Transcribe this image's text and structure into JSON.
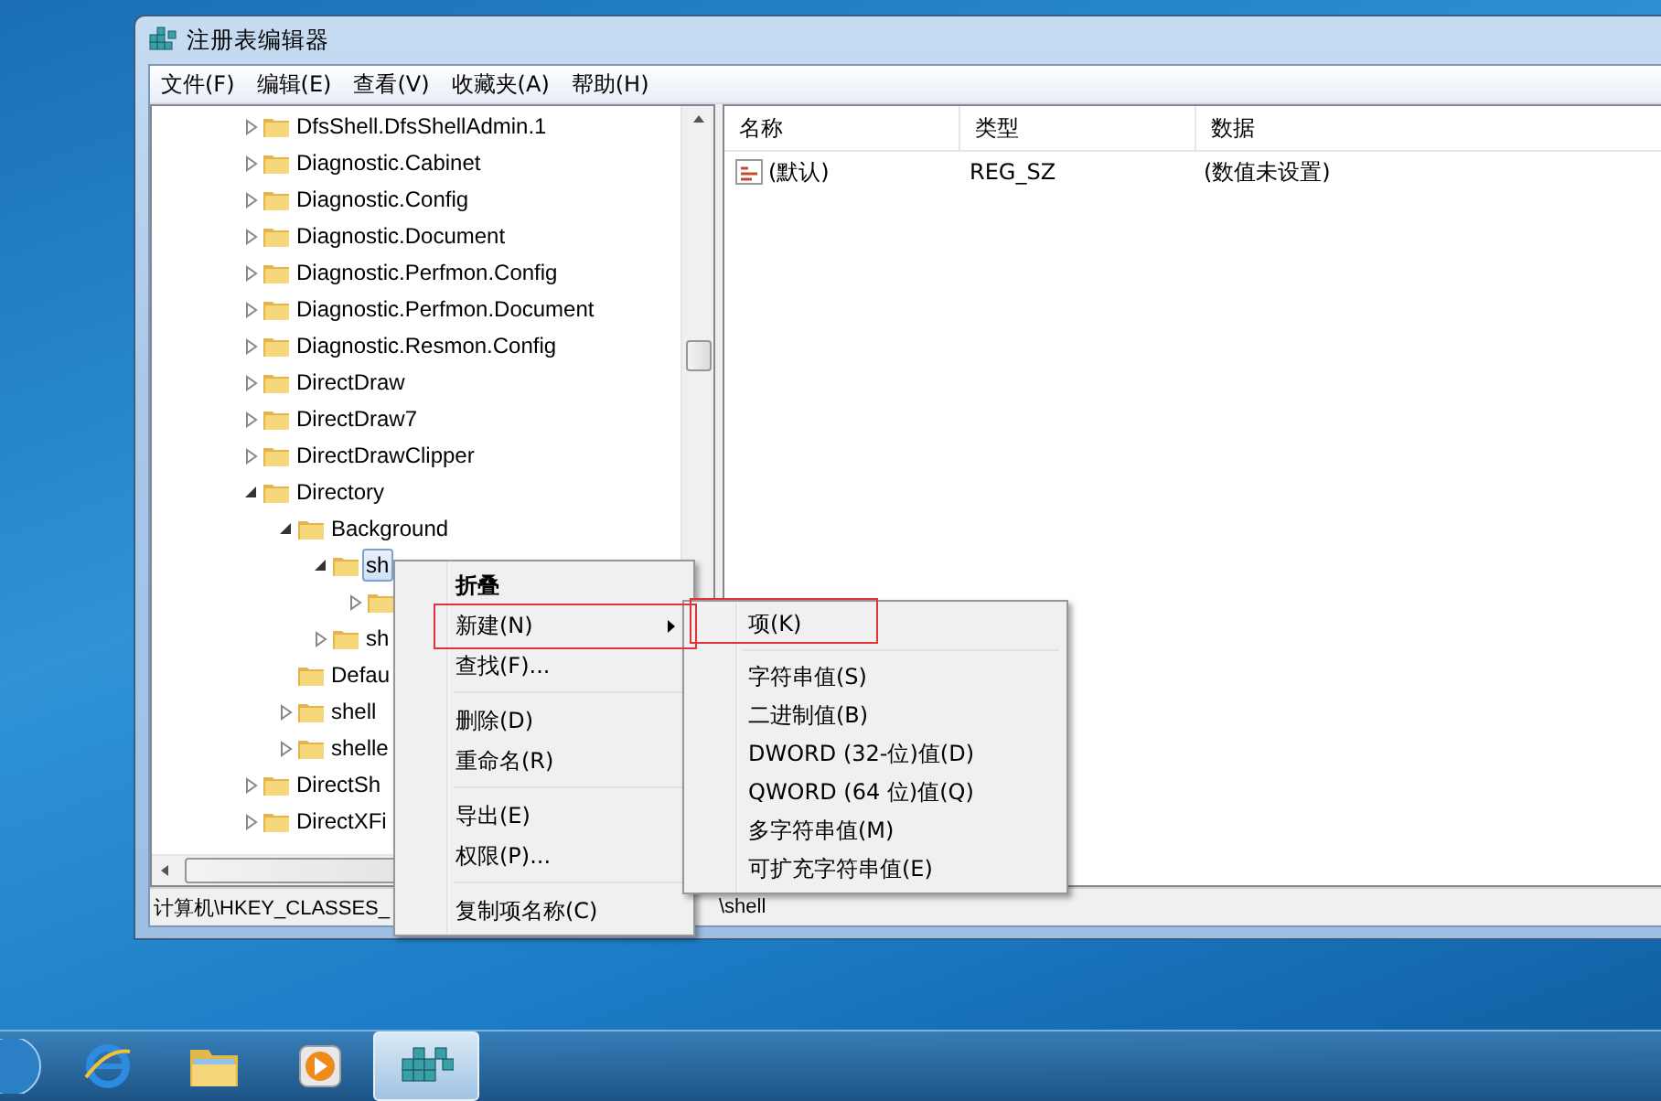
{
  "window": {
    "title": "注册表编辑器"
  },
  "menu_bar": [
    "文件(F)",
    "编辑(E)",
    "查看(V)",
    "收藏夹(A)",
    "帮助(H)"
  ],
  "tree": {
    "items": [
      {
        "label": "DfsShell.DfsShellAdmin.1",
        "kind": "branch",
        "expanded": false,
        "selected": false
      },
      {
        "label": "Diagnostic.Cabinet",
        "kind": "branch",
        "expanded": false,
        "selected": false
      },
      {
        "label": "Diagnostic.Config",
        "kind": "branch",
        "expanded": false,
        "selected": false
      },
      {
        "label": "Diagnostic.Document",
        "kind": "branch",
        "expanded": false,
        "selected": false
      },
      {
        "label": "Diagnostic.Perfmon.Config",
        "kind": "branch",
        "expanded": false,
        "selected": false
      },
      {
        "label": "Diagnostic.Perfmon.Document",
        "kind": "branch",
        "expanded": false,
        "selected": false
      },
      {
        "label": "Diagnostic.Resmon.Config",
        "kind": "branch",
        "expanded": false,
        "selected": false
      },
      {
        "label": "DirectDraw",
        "kind": "branch",
        "expanded": false,
        "selected": false
      },
      {
        "label": "DirectDraw7",
        "kind": "branch",
        "expanded": false,
        "selected": false
      },
      {
        "label": "DirectDrawClipper",
        "kind": "branch",
        "expanded": false,
        "selected": false
      },
      {
        "label": "Directory",
        "kind": "branch",
        "expanded": true,
        "selected": false,
        "children": [
          {
            "label": "Background",
            "kind": "branch",
            "expanded": true,
            "selected": false,
            "children": [
              {
                "label": "sh",
                "kind": "branch",
                "expanded": true,
                "selected": true,
                "children": [
                  {
                    "kind": "branch",
                    "expanded": false,
                    "selected": false
                  }
                ]
              },
              {
                "label": "sh",
                "kind": "branch",
                "expanded": false,
                "selected": false
              }
            ]
          },
          {
            "label": "Defau",
            "kind": "leaf",
            "selected": false
          },
          {
            "label": "shell",
            "kind": "branch",
            "expanded": false,
            "selected": false
          },
          {
            "label": "shelle",
            "kind": "branch",
            "expanded": false,
            "selected": false
          }
        ]
      },
      {
        "label": "DirectSh",
        "kind": "branch",
        "expanded": false,
        "selected": false
      },
      {
        "label": "DirectXFi",
        "kind": "branch",
        "expanded": false,
        "selected": false
      }
    ]
  },
  "values": {
    "columns": [
      "名称",
      "类型",
      "数据"
    ],
    "rows": [
      {
        "name": "(默认)",
        "type": "REG_SZ",
        "data": "(数值未设置)"
      }
    ]
  },
  "status_bar": [
    "计算机\\HKEY_CLASSES_",
    "\\shell"
  ],
  "context_menu": {
    "items": [
      {
        "kind": "item",
        "label": "折叠",
        "bold": true,
        "submenu": false
      },
      {
        "kind": "item",
        "label": "新建(N)",
        "bold": false,
        "submenu": true
      },
      {
        "kind": "item",
        "label": "查找(F)...",
        "bold": false,
        "submenu": false
      },
      {
        "kind": "separator"
      },
      {
        "kind": "item",
        "label": "删除(D)",
        "bold": false,
        "submenu": false
      },
      {
        "kind": "item",
        "label": "重命名(R)",
        "bold": false,
        "submenu": false
      },
      {
        "kind": "separator"
      },
      {
        "kind": "item",
        "label": "导出(E)",
        "bold": false,
        "submenu": false
      },
      {
        "kind": "item",
        "label": "权限(P)...",
        "bold": false,
        "submenu": false
      },
      {
        "kind": "separator"
      },
      {
        "kind": "item",
        "label": "复制项名称(C)",
        "bold": false,
        "submenu": false
      }
    ]
  },
  "submenu": {
    "items": [
      {
        "kind": "item",
        "label": "项(K)"
      },
      {
        "kind": "separator"
      },
      {
        "kind": "item",
        "label": "字符串值(S)"
      },
      {
        "kind": "item",
        "label": "二进制值(B)"
      },
      {
        "kind": "item",
        "label": "DWORD (32-位)值(D)"
      },
      {
        "kind": "item",
        "label": "QWORD (64 位)值(Q)"
      },
      {
        "kind": "item",
        "label": "多字符串值(M)"
      },
      {
        "kind": "item",
        "label": "可扩充字符串值(E)"
      }
    ]
  },
  "taskbar": {
    "apps": [
      {
        "kind": "browser",
        "selected": false
      },
      {
        "kind": "folders",
        "selected": false
      },
      {
        "kind": "media",
        "selected": false
      },
      {
        "kind": "registry",
        "selected": true
      }
    ]
  }
}
